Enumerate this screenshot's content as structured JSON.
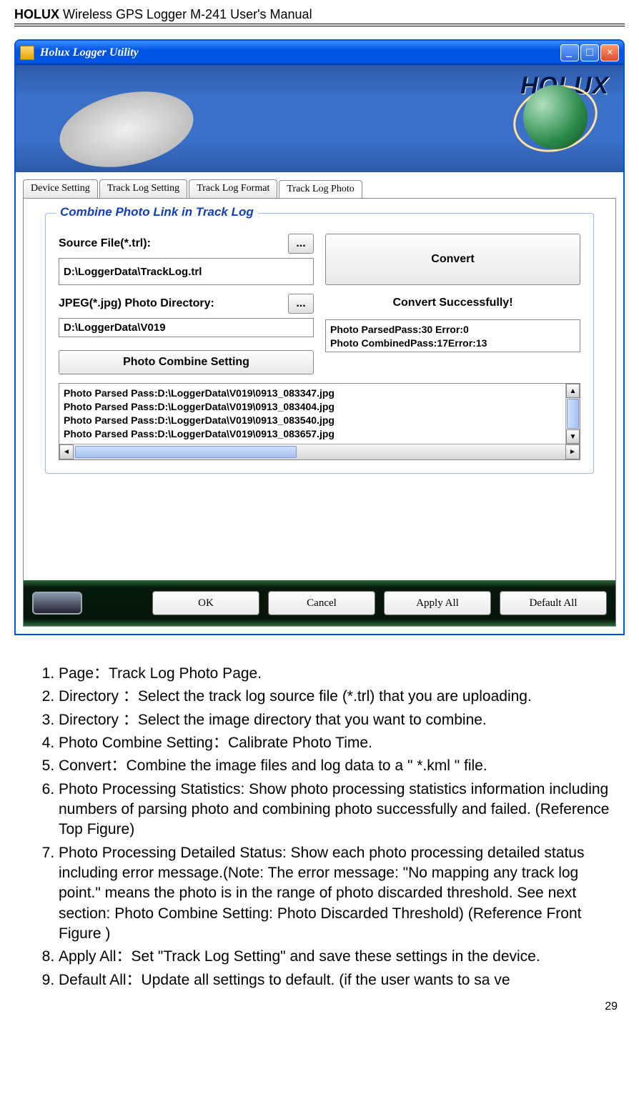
{
  "doc_header_bold": "HOLUX",
  "doc_header_rest": " Wireless GPS Logger M-241 User's Manual",
  "page_number": "29",
  "window": {
    "title": "Holux Logger Utility",
    "brand": "HOLUX",
    "tabs": [
      "Device Setting",
      "Track Log Setting",
      "Track Log Format",
      "Track Log Photo"
    ],
    "active_tab_index": 3,
    "group_title": "Combine Photo Link in Track Log",
    "source_label": "Source File(*.trl):",
    "source_value": "D:\\LoggerData\\TrackLog.trl",
    "jpeg_label": "JPEG(*.jpg) Photo Directory:",
    "jpeg_value": "D:\\LoggerData\\V019",
    "browse_label": "...",
    "convert_btn": "Convert",
    "convert_status": "Convert Successfully!",
    "stats_text": "Photo ParsedPass:30 Error:0\nPhoto CombinedPass:17Error:13",
    "pcs_btn": "Photo Combine Setting",
    "log_lines": "Photo Parsed Pass:D:\\LoggerData\\V019\\0913_083347.jpg\nPhoto Parsed Pass:D:\\LoggerData\\V019\\0913_083404.jpg\nPhoto Parsed Pass:D:\\LoggerData\\V019\\0913_083540.jpg\nPhoto Parsed Pass:D:\\LoggerData\\V019\\0913_083657.jpg",
    "footer_buttons": [
      "OK",
      "Cancel",
      "Apply All",
      "Default All"
    ]
  },
  "list_items": [
    "Page：Track Log Photo Page.",
    "Directory  ：Select the track log source file (*.trl) that you are uploading.",
    "Directory  ：Select the image directory that you want to combine.",
    "Photo Combine Setting：Calibrate Photo Time.",
    "Convert：Combine the image files and log data to a \" *.kml \" file.",
    "Photo Processing Statistics: Show photo processing statistics information including numbers of parsing photo and combining photo successfully and failed. (Reference Top Figure)",
    "Photo Processing Detailed Status: Show each photo processing detailed status including error message.(Note: The error message: \"No mapping any track log point.\" means the photo is in the range of photo discarded threshold. See next section: Photo Combine Setting: Photo Discarded Threshold) (Reference Front Figure )",
    "Apply All：Set \"Track Log Setting\" and save these settings in the device.",
    "Default All：Update all settings to default. (if the user wants to sa ve"
  ]
}
